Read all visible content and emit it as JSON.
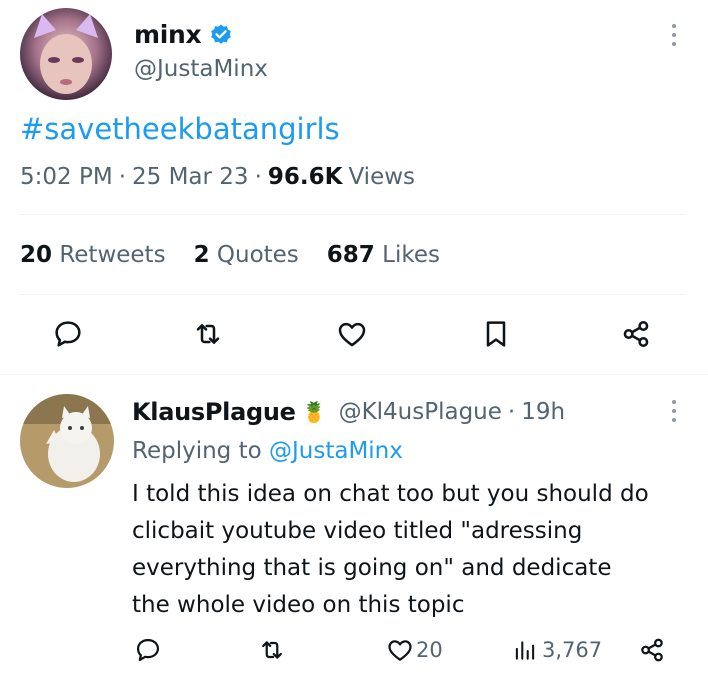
{
  "tweet": {
    "author_name": "minx",
    "author_handle": "@JustaMinx",
    "verified": true,
    "hashtag": "#savetheekbatangirls",
    "time": "5:02 PM",
    "sep1": "·",
    "date": "25 Mar 23",
    "sep2": "·",
    "views_count": "96.6K",
    "views_label": "Views",
    "stats": {
      "retweets_count": "20",
      "retweets_label": "Retweets",
      "quotes_count": "2",
      "quotes_label": "Quotes",
      "likes_count": "687",
      "likes_label": "Likes"
    },
    "actions": [
      "reply-icon",
      "retweet-icon",
      "like-icon",
      "bookmark-icon",
      "share-icon"
    ]
  },
  "reply": {
    "author_name": "KlausPlague",
    "author_emoji": "🍍",
    "author_handle": "@Kl4usPlague",
    "sep": "·",
    "time_ago": "19h",
    "replying_prefix": "Replying to",
    "replying_handle": "@JustaMinx",
    "text_lines": [
      "I told this idea on chat too but you should do",
      "clicbait youtube video titled \"adressing",
      "everything that is going on\" and dedicate",
      "the whole video on this topic"
    ],
    "likes": "20",
    "views": "3,767"
  },
  "colors": {
    "accent": "#1d9bf0",
    "text": "#0f1419",
    "muted": "#536471",
    "divider": "#eff3f4"
  }
}
